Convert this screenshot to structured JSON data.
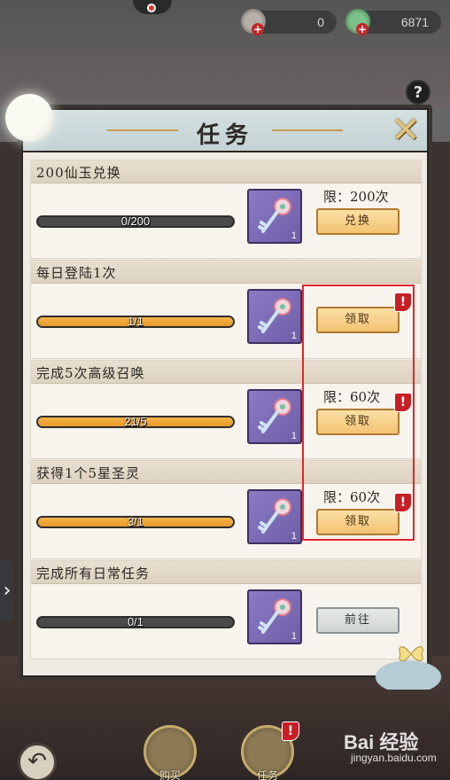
{
  "hud": {
    "currency_1": {
      "value": "0",
      "icon": "horn-icon"
    },
    "currency_2": {
      "value": "6871",
      "icon": "jade-coin-icon"
    }
  },
  "dialog": {
    "title": "任务",
    "close_label": "✕"
  },
  "tasks": [
    {
      "title": "200仙玉兑换",
      "progress_text": "0/200",
      "progress": 0.0,
      "reward_count": "1",
      "limit": "限：200次",
      "button": "兑换",
      "button_style": "gold",
      "alert": false
    },
    {
      "title": "每日登陆1次",
      "progress_text": "1/1",
      "progress": 1.0,
      "reward_count": "1",
      "limit": "",
      "button": "领取",
      "button_style": "gold",
      "alert": true
    },
    {
      "title": "完成5次高级召唤",
      "progress_text": "21/5",
      "progress": 1.0,
      "reward_count": "1",
      "limit": "限：60次",
      "button": "领取",
      "button_style": "gold",
      "alert": true
    },
    {
      "title": "获得1个5星圣灵",
      "progress_text": "3/1",
      "progress": 1.0,
      "reward_count": "1",
      "limit": "限：60次",
      "button": "领取",
      "button_style": "gold",
      "alert": true
    },
    {
      "title": "完成所有日常任务",
      "progress_text": "0/1",
      "progress": 0.0,
      "reward_count": "1",
      "limit": "",
      "button": "前往",
      "button_style": "grey",
      "alert": false
    }
  ],
  "bottom_nav": {
    "items": [
      {
        "label": "购买"
      },
      {
        "label": "任务"
      }
    ]
  },
  "watermark": {
    "main": "Bai 经验",
    "sub": "jingyan.baidu.com"
  },
  "colors": {
    "progress_fill": "#e89a2a",
    "button_gold": "#f3c271",
    "alert_red": "#c81e25",
    "highlight_red": "#e0262a"
  }
}
